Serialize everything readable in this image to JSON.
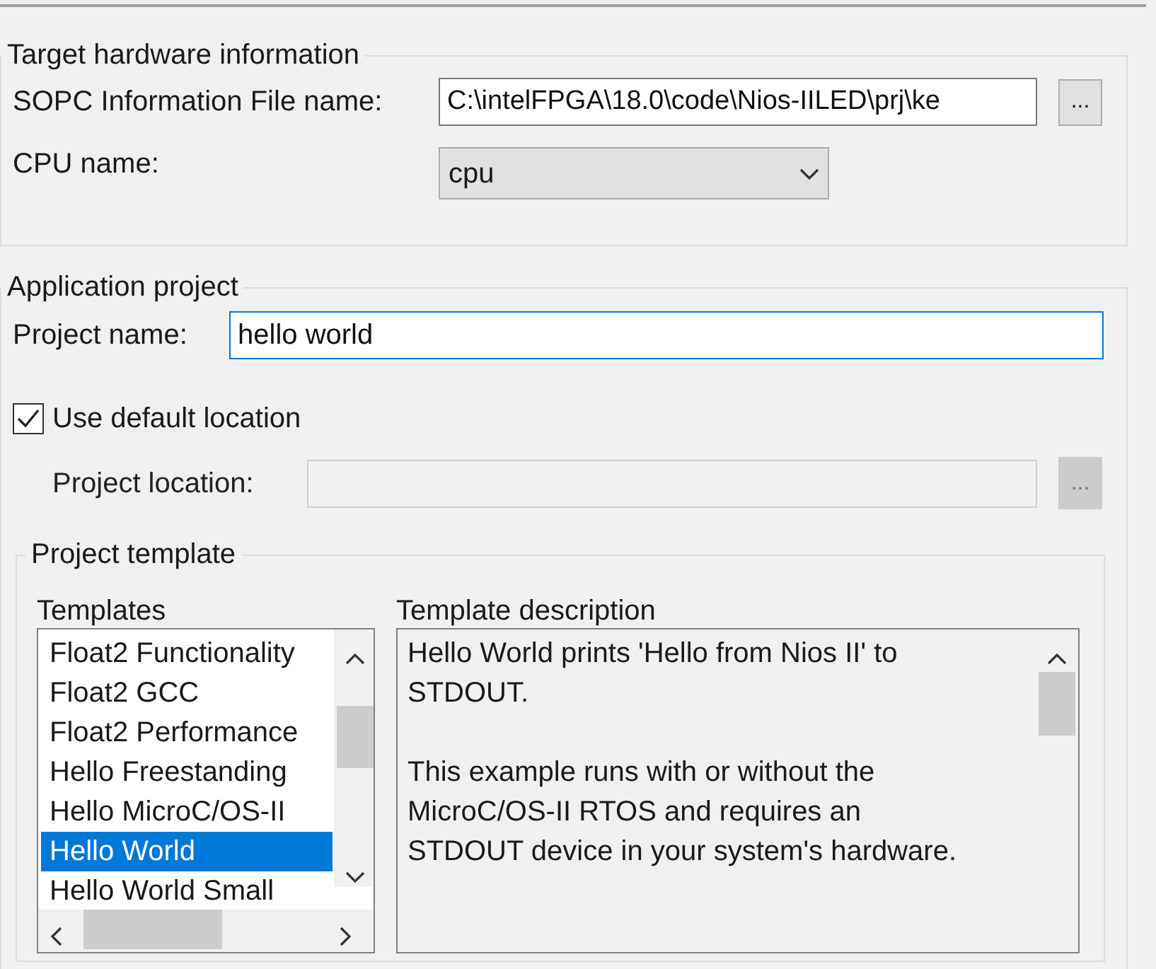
{
  "target_hardware": {
    "title": "Target hardware information",
    "sopc_label": "SOPC Information File name:",
    "sopc_value": "C:\\intelFPGA\\18.0\\code\\Nios-IILED\\prj\\ke",
    "sopc_browse": "...",
    "cpu_label": "CPU name:",
    "cpu_value": "cpu"
  },
  "application_project": {
    "title": "Application project",
    "project_name_label": "Project name:",
    "project_name_value": "hello world",
    "use_default_location": {
      "label": "Use default location",
      "checked": true
    },
    "project_location": {
      "label": "Project location:",
      "disabled": true,
      "browse": "..."
    },
    "project_template": {
      "title": "Project template",
      "templates_label": "Templates",
      "templates": [
        {
          "label": "Float2 Functionality",
          "selected": false
        },
        {
          "label": "Float2 GCC",
          "selected": false
        },
        {
          "label": "Float2 Performance",
          "selected": false
        },
        {
          "label": "Hello Freestanding",
          "selected": false
        },
        {
          "label": "Hello MicroC/OS-II",
          "selected": false
        },
        {
          "label": "Hello World",
          "selected": true
        },
        {
          "label": "Hello World Small",
          "selected": false
        }
      ],
      "description_label": "Template description",
      "description": [
        [
          "Hello World prints 'Hello from Nios II' to",
          "STDOUT."
        ],
        [
          "This example runs with or without the",
          "MicroC/OS-II RTOS and requires an",
          "STDOUT device in your system's hardware."
        ]
      ]
    }
  }
}
